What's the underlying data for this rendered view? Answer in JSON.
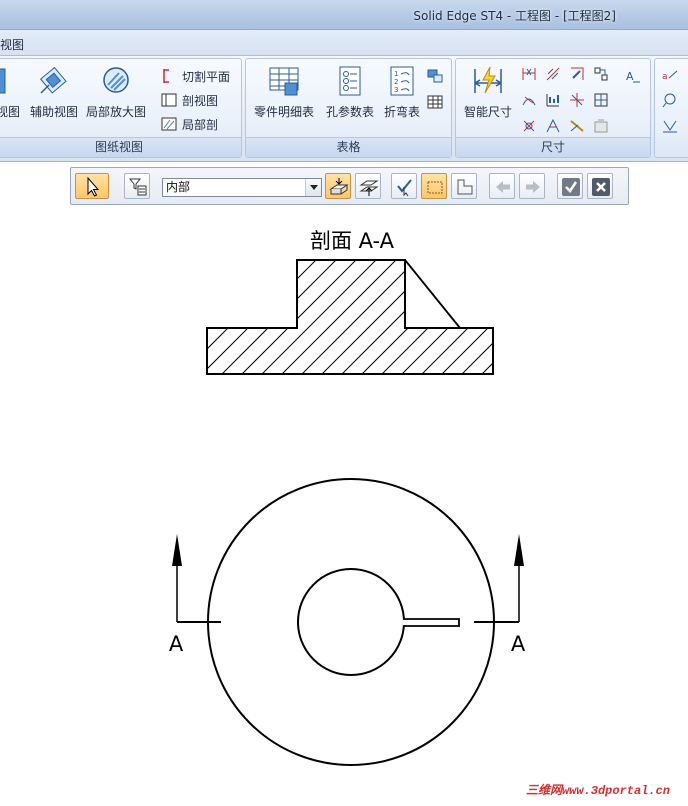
{
  "window": {
    "title": "Solid Edge ST4 - 工程图 - [工程图2]"
  },
  "tabs": {
    "active": "视图"
  },
  "ribbon": {
    "groups": [
      {
        "label": "图纸视图",
        "big_buttons": [
          "视图",
          "辅助视图",
          "局部放大图"
        ],
        "small_buttons": [
          "切割平面",
          "剖视图",
          "局部剖"
        ]
      },
      {
        "label": "表格",
        "big_buttons": [
          "零件明细表",
          "孔参数表",
          "折弯表"
        ]
      },
      {
        "label": "尺寸",
        "big_buttons": [
          "智能尺寸"
        ]
      }
    ]
  },
  "select_toolbar": {
    "filter_value": "内部"
  },
  "drawing": {
    "section_title": "剖面 A-A",
    "cut_label_left": "A",
    "cut_label_right": "A"
  },
  "watermark": "三维网www.3dportal.cn",
  "colors": {
    "accent_active": "#ffc56a",
    "line": "#000000",
    "watermark": "#d43030"
  }
}
